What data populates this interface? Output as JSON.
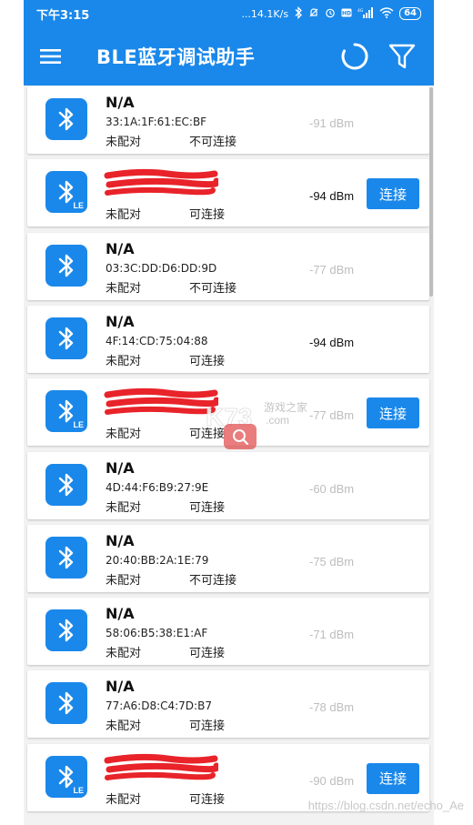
{
  "status_bar": {
    "time": "下午3:15",
    "network_speed": "...14.1K/s",
    "battery": "64"
  },
  "app_bar": {
    "title": "BLE蓝牙调试助手",
    "menu_icon": "hamburger-menu-icon",
    "refresh_icon": "refresh-spinner-icon",
    "filter_icon": "filter-funnel-icon"
  },
  "colors": {
    "primary": "#1a88ea",
    "card_bg": "#ffffff",
    "list_bg": "#f2f2f2",
    "rssi_dim": "#bdbdbd",
    "redaction": "#e8232a"
  },
  "devices": [
    {
      "name": "N/A",
      "mac": "33:1A:1F:61:EC:BF",
      "bond": "未配对",
      "connectable": "不可连接",
      "rssi": "-91 dBm",
      "le": false,
      "dim": true,
      "connect": ""
    },
    {
      "name": "",
      "mac": "",
      "bond": "未配对",
      "connectable": "可连接",
      "rssi": "-94 dBm",
      "le": true,
      "dim": false,
      "connect": "连接"
    },
    {
      "name": "N/A",
      "mac": "03:3C:DD:D6:DD:9D",
      "bond": "未配对",
      "connectable": "不可连接",
      "rssi": "-77 dBm",
      "le": false,
      "dim": true,
      "connect": ""
    },
    {
      "name": "N/A",
      "mac": "4F:14:CD:75:04:88",
      "bond": "未配对",
      "connectable": "可连接",
      "rssi": "-94 dBm",
      "le": false,
      "dim": false,
      "connect": ""
    },
    {
      "name": "",
      "mac": "",
      "bond": "未配对",
      "connectable": "可连接",
      "rssi": "-77 dBm",
      "le": true,
      "dim": true,
      "connect": "连接"
    },
    {
      "name": "N/A",
      "mac": "4D:44:F6:B9:27:9E",
      "bond": "未配对",
      "connectable": "可连接",
      "rssi": "-60 dBm",
      "le": false,
      "dim": true,
      "connect": ""
    },
    {
      "name": "N/A",
      "mac": "20:40:BB:2A:1E:79",
      "bond": "未配对",
      "connectable": "不可连接",
      "rssi": "-75 dBm",
      "le": false,
      "dim": true,
      "connect": ""
    },
    {
      "name": "N/A",
      "mac": "58:06:B5:38:E1:AF",
      "bond": "未配对",
      "connectable": "可连接",
      "rssi": "-71 dBm",
      "le": false,
      "dim": true,
      "connect": ""
    },
    {
      "name": "N/A",
      "mac": "77:A6:D8:C4:7D:B7",
      "bond": "未配对",
      "connectable": "可连接",
      "rssi": "-78 dBm",
      "le": false,
      "dim": true,
      "connect": ""
    },
    {
      "name": "",
      "mac": "",
      "bond": "未配对",
      "connectable": "可连接",
      "rssi": "-90 dBm",
      "le": true,
      "dim": true,
      "connect": "连接"
    }
  ],
  "watermark": {
    "logo_text": "K73",
    "site_name": "游戏之家",
    "site_domain": ".com",
    "url_text": "https://blog.csdn.net/echo_Ae"
  }
}
